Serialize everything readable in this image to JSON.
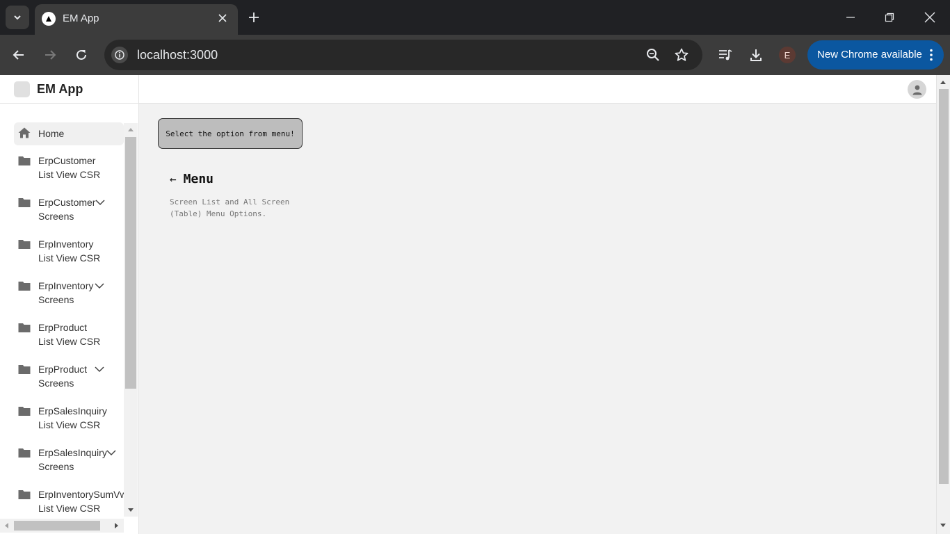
{
  "browser": {
    "tab_title": "EM App",
    "url": "localhost:3000",
    "profile_initial": "E",
    "update_label": "New Chrome available"
  },
  "app": {
    "title": "EM App"
  },
  "sidebar": {
    "items": [
      {
        "line1": "Home",
        "line2": "",
        "icon": "home-icon",
        "expandable": false
      },
      {
        "line1": "ErpCustomer",
        "line2": "List View CSR",
        "icon": "folder-icon",
        "expandable": false
      },
      {
        "line1": "ErpCustomer",
        "line2": "Screens",
        "icon": "folder-icon",
        "expandable": true
      },
      {
        "line1": "ErpInventory",
        "line2": "List View CSR",
        "icon": "folder-icon",
        "expandable": false
      },
      {
        "line1": "ErpInventory",
        "line2": "Screens",
        "icon": "folder-icon",
        "expandable": true
      },
      {
        "line1": "ErpProduct",
        "line2": "List View CSR",
        "icon": "folder-icon",
        "expandable": false
      },
      {
        "line1": "ErpProduct",
        "line2": "Screens",
        "icon": "folder-icon",
        "expandable": true
      },
      {
        "line1": "ErpSalesInquiry",
        "line2": "List View CSR",
        "icon": "folder-icon",
        "expandable": false
      },
      {
        "line1": "ErpSalesInquiry",
        "line2": "Screens",
        "icon": "folder-icon",
        "expandable": true
      },
      {
        "line1": "ErpInventorySumVw",
        "line2": "List View CSR",
        "icon": "folder-icon",
        "expandable": false
      }
    ]
  },
  "main": {
    "notice": "Select the option from menu!",
    "menu_arrow": "←",
    "menu_title": "Menu",
    "menu_desc": "Screen List and All Screen (Table) Menu Options."
  },
  "colors": {
    "chrome_dark": "#202124",
    "toolbar": "#3c3c3c",
    "update_blue": "#0b57a0",
    "page_bg": "#f2f2f2",
    "notice_bg": "#bdbdbd"
  }
}
